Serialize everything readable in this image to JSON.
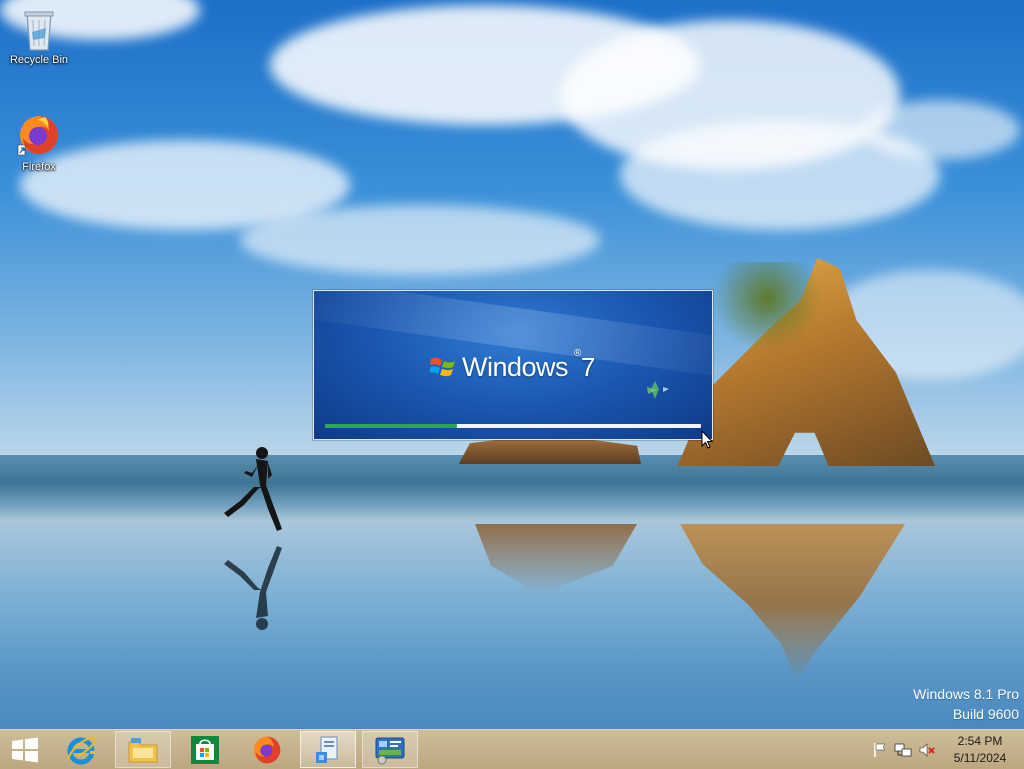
{
  "desktop": {
    "icons": [
      {
        "label": "Recycle Bin",
        "icon": "recycle-bin-icon"
      },
      {
        "label": "Firefox",
        "icon": "firefox-icon"
      }
    ]
  },
  "splash": {
    "brand": "Windows",
    "version": "7",
    "progress_fraction": 0.35,
    "colors": {
      "bg": "#1a56b0",
      "progress": "#2ca84a",
      "track": "#f2f5f9"
    }
  },
  "watermark": {
    "edition": "Windows 8.1 Pro",
    "build": "Build 9600"
  },
  "taskbar": {
    "buttons": [
      {
        "name": "start",
        "icon": "windows-logo-icon"
      },
      {
        "name": "internet-explorer",
        "icon": "internet-explorer-icon"
      },
      {
        "name": "file-explorer",
        "icon": "file-explorer-icon"
      },
      {
        "name": "store",
        "icon": "store-icon"
      },
      {
        "name": "firefox",
        "icon": "firefox-icon"
      },
      {
        "name": "setup",
        "icon": "setup-icon"
      },
      {
        "name": "control-panel",
        "icon": "control-panel-icon"
      }
    ],
    "tray": [
      "action-center-flag-icon",
      "network-icon",
      "volume-muted-icon"
    ],
    "clock": {
      "time": "2:54 PM",
      "date": "5/11/2024"
    },
    "color": "#bca77f"
  }
}
